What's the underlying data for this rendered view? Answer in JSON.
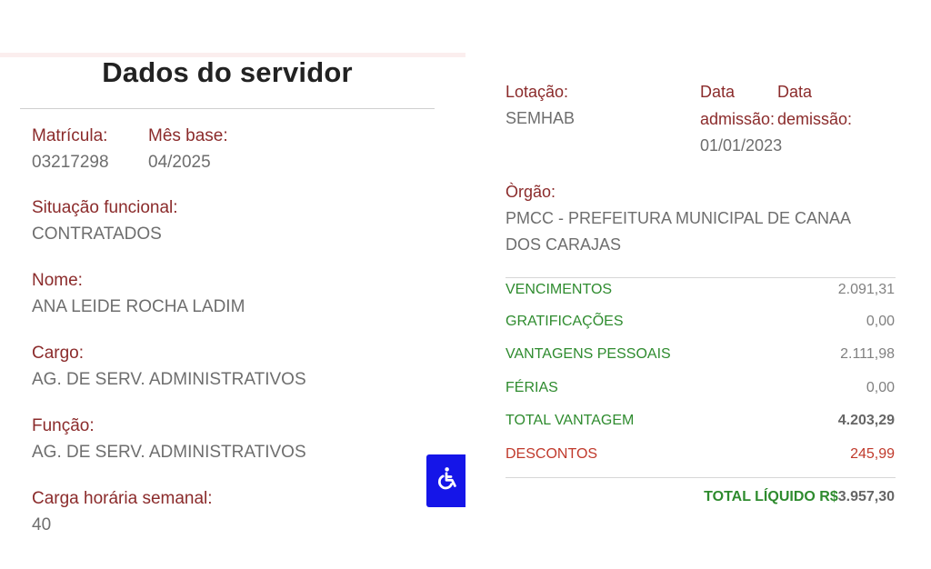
{
  "header": {
    "title": "Dados do servidor"
  },
  "left": {
    "matricula": {
      "label": "Matrícula:",
      "value": "03217298"
    },
    "mes_base": {
      "label": "Mês base:",
      "value": "04/2025"
    },
    "situacao": {
      "label": "Situação funcional:",
      "value": "CONTRATADOS"
    },
    "nome": {
      "label": "Nome:",
      "value": "ANA LEIDE ROCHA LADIM"
    },
    "cargo": {
      "label": "Cargo:",
      "value": "AG. DE SERV. ADMINISTRATIVOS"
    },
    "funcao": {
      "label": "Função:",
      "value": "AG. DE SERV. ADMINISTRATIVOS"
    },
    "carga": {
      "label": "Carga horária semanal:",
      "value": "40"
    }
  },
  "right": {
    "lotacao": {
      "label": "Lotação:",
      "value": "SEMHAB"
    },
    "data_admissao": {
      "label_line1": "Data",
      "label_line2": "admissão:",
      "value": "01/01/2023"
    },
    "data_demissao": {
      "label_line1": "Data",
      "label_line2": "demissão:"
    },
    "orgao": {
      "label": "Òrgão:",
      "value_line1": "PMCC - PREFEITURA MUNICIPAL DE CANAA",
      "value_line2": "DOS CARAJAS"
    }
  },
  "financial": {
    "rows": [
      {
        "label": "VENCIMENTOS",
        "value": "2.091,31"
      },
      {
        "label": "GRATIFICAÇÕES",
        "value": "0,00"
      },
      {
        "label": "VANTAGENS PESSOAIS",
        "value": "2.111,98"
      },
      {
        "label": "FÉRIAS",
        "value": "0,00"
      },
      {
        "label": "TOTAL VANTAGEM",
        "value": "4.203,29"
      },
      {
        "label": "DESCONTOS",
        "value": "245,99"
      }
    ],
    "total_label": "TOTAL LÍQUIDO R$",
    "total_value": "3.957,30"
  },
  "accessibility": {
    "icon": "wheelchair-icon"
  },
  "colors": {
    "label": "#8b2b2b",
    "value": "#6e6e6e",
    "finance_green": "#2e8b2e",
    "discount_red": "#c0392b",
    "accessibility_blue": "#1515e8"
  }
}
